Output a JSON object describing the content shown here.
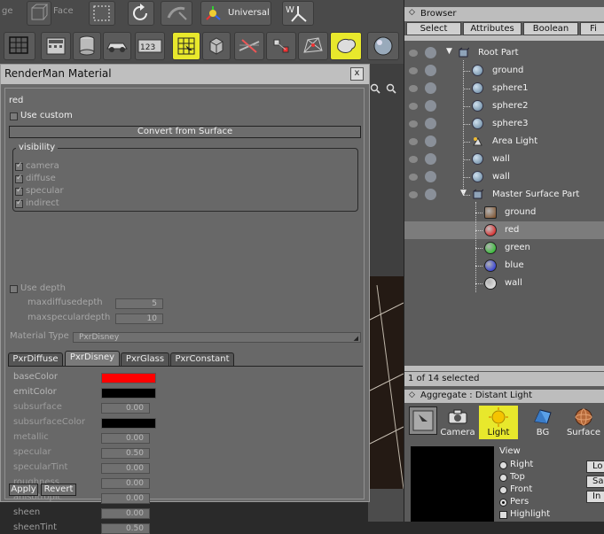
{
  "toolbar": {
    "edge_label": "ge",
    "face_label": "Face",
    "universal_label": "Universal"
  },
  "dialog": {
    "title": "RenderMan Material",
    "close": "x",
    "material_name": "red",
    "use_custom": "Use custom",
    "convert_button": "Convert from Surface",
    "visibility_group": "visibility",
    "visibility_items": [
      "camera",
      "diffuse",
      "specular",
      "indirect"
    ],
    "use_depth": "Use depth",
    "maxdiffusedepth_label": "maxdiffusedepth",
    "maxdiffusedepth_value": "5",
    "maxspeculardepth_label": "maxspeculardepth",
    "maxspeculardepth_value": "10",
    "material_type_label": "Material Type",
    "material_type_value": "PxrDisney",
    "tabs": [
      "PxrDiffuse",
      "PxrDisney",
      "PxrGlass",
      "PxrConstant"
    ],
    "active_tab": "PxrDisney",
    "params": [
      {
        "label": "baseColor",
        "value": "",
        "color": "#ff0000"
      },
      {
        "label": "emitColor",
        "value": "",
        "color": "#000000"
      },
      {
        "label": "subsurface",
        "value": "0.00"
      },
      {
        "label": "subsurfaceColor",
        "value": "",
        "color": "#000000"
      },
      {
        "label": "metallic",
        "value": "0.00"
      },
      {
        "label": "specular",
        "value": "0.50"
      },
      {
        "label": "specularTint",
        "value": "0.00"
      },
      {
        "label": "roughness",
        "value": "0.00"
      },
      {
        "label": "anisotropic",
        "value": "0.00"
      },
      {
        "label": "sheen",
        "value": "0.00"
      },
      {
        "label": "sheenTint",
        "value": "0.50"
      }
    ],
    "apply_button": "Apply",
    "revert_button": "Revert"
  },
  "browser": {
    "title": "Browser",
    "tabs": [
      "Select",
      "Attributes",
      "Boolean",
      "Fi"
    ],
    "tree": [
      {
        "label": "Root Part",
        "icon": "part-icon",
        "depth": 0
      },
      {
        "label": "ground",
        "icon": "sphere-mesh-icon",
        "depth": 1
      },
      {
        "label": "sphere1",
        "icon": "sphere-mesh-icon",
        "depth": 1
      },
      {
        "label": "sphere2",
        "icon": "sphere-mesh-icon",
        "depth": 1
      },
      {
        "label": "sphere3",
        "icon": "sphere-mesh-icon",
        "depth": 1
      },
      {
        "label": "Area Light",
        "icon": "area-light-icon",
        "depth": 1
      },
      {
        "label": "wall",
        "icon": "sphere-mesh-icon",
        "depth": 1
      },
      {
        "label": "wall",
        "icon": "sphere-mesh-icon",
        "depth": 1
      },
      {
        "label": "Master Surface Part",
        "icon": "part-icon",
        "depth": 1
      },
      {
        "label": "ground",
        "icon": "material-swatch-icon",
        "color": "#7a4a22",
        "depth": 2
      },
      {
        "label": "red",
        "icon": "material-swatch-icon",
        "color": "#e00000",
        "depth": 2,
        "selected": true
      },
      {
        "label": "green",
        "icon": "material-swatch-icon",
        "color": "#10c010",
        "depth": 2
      },
      {
        "label": "blue",
        "icon": "material-swatch-icon",
        "color": "#1020e0",
        "depth": 2
      },
      {
        "label": "wall",
        "icon": "material-swatch-icon",
        "color": "#f0f0f0",
        "depth": 2
      }
    ],
    "status": "1 of 14 selected"
  },
  "aggregate": {
    "title": "Aggregate : Distant Light",
    "icons": [
      "Camera",
      "Light",
      "BG",
      "Surface"
    ],
    "view_label": "View",
    "view_options": [
      "Right",
      "Top",
      "Front",
      "Pers"
    ],
    "selected_view": "Pers",
    "highlight": "Highlight",
    "buttons": [
      "Lo",
      "Sa",
      "In"
    ]
  },
  "colors": {
    "accent_yellow": "#e8e82c",
    "selection": "#7c7c7c"
  }
}
